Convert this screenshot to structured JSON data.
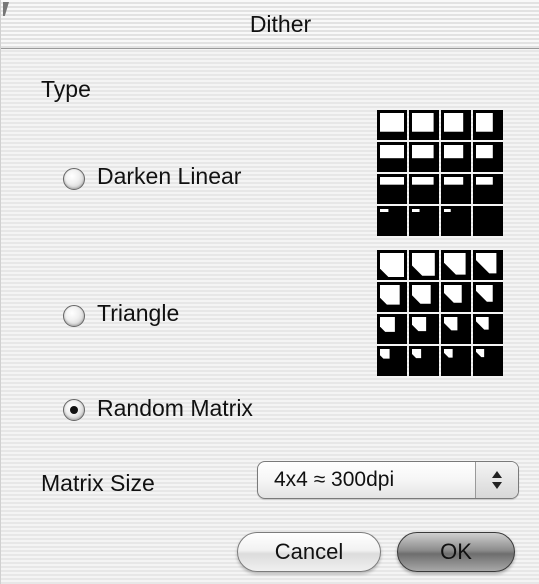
{
  "window": {
    "title": "Dither"
  },
  "type_section": {
    "label": "Type",
    "options": [
      {
        "label": "Darken Linear",
        "checked": false,
        "icon": "darken-linear-pattern-icon"
      },
      {
        "label": "Triangle",
        "checked": false,
        "icon": "triangle-pattern-icon"
      },
      {
        "label": "Random Matrix",
        "checked": true,
        "icon": ""
      }
    ]
  },
  "matrix_size": {
    "label": "Matrix Size",
    "value": "4x4 ≈ 300dpi",
    "icon": "up-down-arrows-icon"
  },
  "buttons": {
    "cancel": "Cancel",
    "ok": "OK"
  },
  "colors": {
    "background": "#ececec",
    "pattern_fill": "#000000",
    "pattern_blank": "#ffffff"
  }
}
